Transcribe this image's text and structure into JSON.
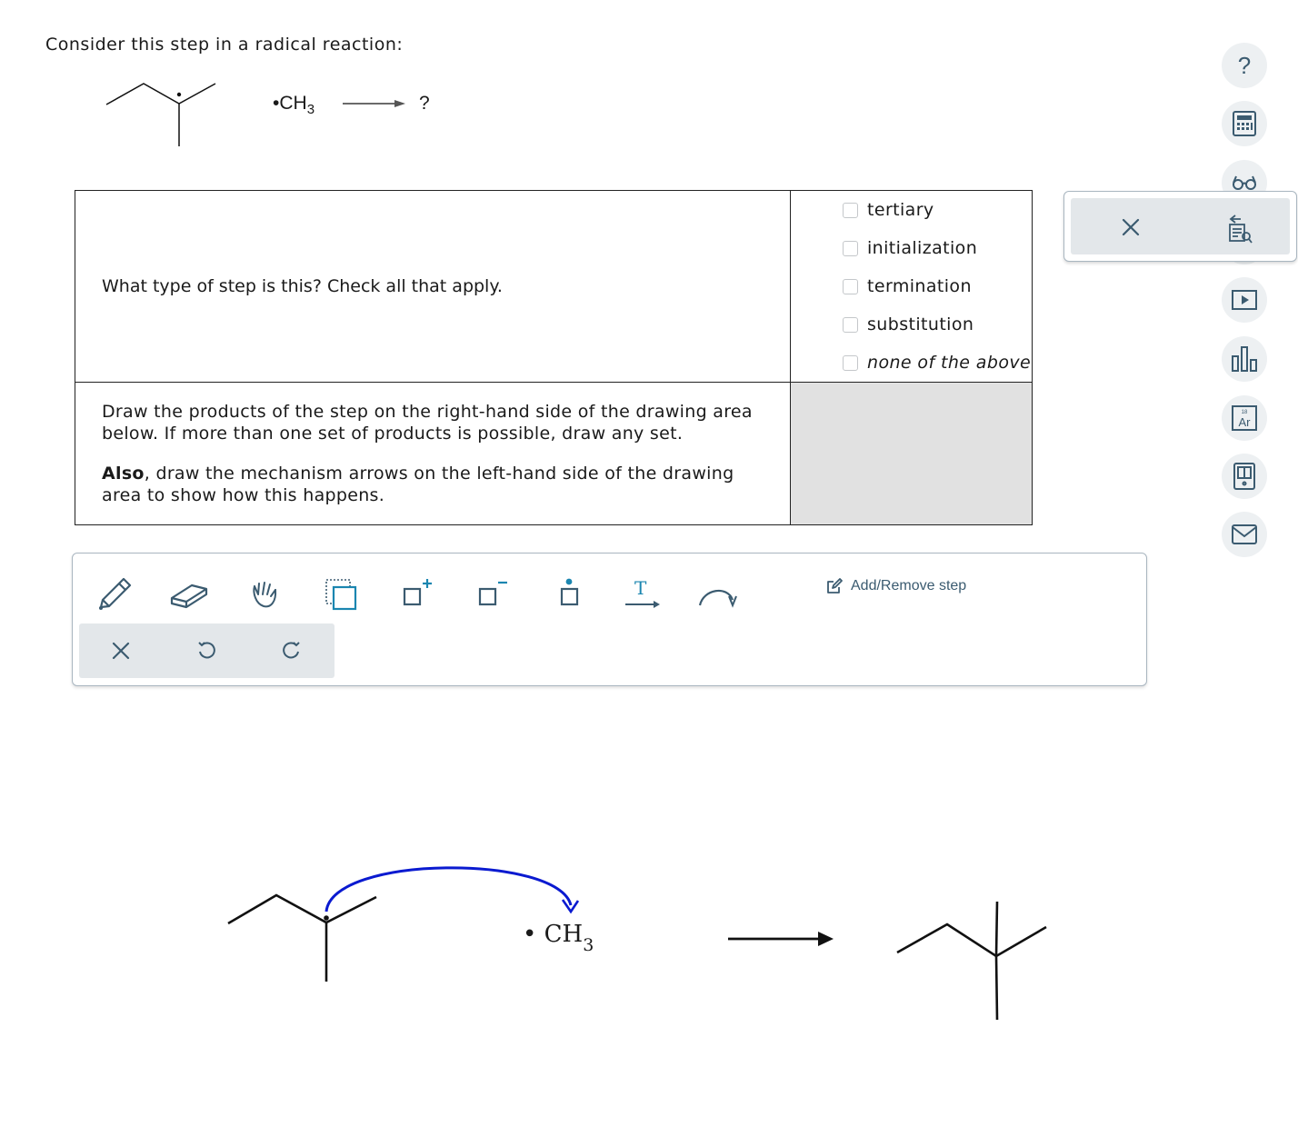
{
  "prompt": "Consider this step in a radical reaction:",
  "reaction": {
    "reagent_dot": "•",
    "reagent_main": "CH",
    "reagent_sub": "3",
    "product_placeholder": "?"
  },
  "question": {
    "text": "What type of step is this? Check all that apply.",
    "options": [
      {
        "label": "tertiary",
        "checked": false
      },
      {
        "label": "initialization",
        "checked": false
      },
      {
        "label": "termination",
        "checked": false
      },
      {
        "label": "substitution",
        "checked": false
      },
      {
        "label": "none of the above",
        "checked": false
      }
    ],
    "draw_instructions_1": "Draw the products of the step on the right-hand side of the drawing area below. If more than one set of products is possible, draw any set.",
    "draw_instructions_2_bold": "Also",
    "draw_instructions_2_rest": ", draw the mechanism arrows on the left-hand side of the drawing area to show how this happens."
  },
  "toolbar": {
    "tools": [
      "pencil-icon",
      "eraser-icon",
      "hand-icon",
      "select-icon",
      "add-charge-icon",
      "remove-charge-icon",
      "radical-icon",
      "text-arrow-icon",
      "curved-arrow-icon"
    ],
    "add_remove_label": "Add/Remove step",
    "sub_actions": [
      "clear-icon",
      "undo-icon",
      "redo-icon"
    ]
  },
  "canvas": {
    "reagent_dot": "•",
    "reagent_main": "CH",
    "reagent_sub": "3",
    "arrow_color": "#0a1ad0"
  },
  "side_tools": [
    "help-icon",
    "calculator-icon",
    "reading-glasses-icon",
    "switch-icon",
    "video-icon",
    "chart-icon",
    "periodic-table-icon",
    "ebook-icon",
    "mail-icon"
  ],
  "side_tools_help_label": "?",
  "periodic_icon_text": {
    "number": "18",
    "symbol": "Ar"
  },
  "accent": "#3b5b70"
}
